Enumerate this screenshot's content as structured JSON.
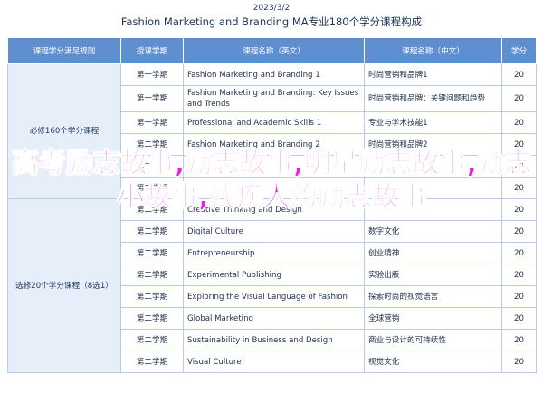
{
  "page": {
    "top_label": "2023/3/2",
    "title": "Fashion Marketing and Branding MA专业180个学分课程构成"
  },
  "table": {
    "headers": [
      "课程学分满足规则",
      "授课学期",
      "课程名称（英文）",
      "课程名称（中文）",
      "学分"
    ],
    "groups": [
      {
        "category": "必修160个学分课程",
        "rows": [
          {
            "semester": "第一学期",
            "en": "Fashion Marketing and Branding 1",
            "zh": "时尚营销和品牌1",
            "credit": "20"
          },
          {
            "semester": "第一学期",
            "en": "Fashion Marketing and Branding: Key Issues and Trends",
            "zh": "时尚营销和品牌：关键问题和趋势",
            "credit": "20"
          },
          {
            "semester": "第一学期",
            "en": "Professional and Academic Skills 1",
            "zh": "专业与学术技能1",
            "credit": "20"
          },
          {
            "semester": "第二学期",
            "en": "Fashion Marketing and Branding 2",
            "zh": "时尚营销和品牌2",
            "credit": "20"
          },
          {
            "semester": "第二学期",
            "en": "",
            "zh": "",
            "credit": "20"
          },
          {
            "semester": "第二学期",
            "en": "",
            "zh": "",
            "credit": "20"
          }
        ]
      },
      {
        "category": "选修20个学分课程（8选1）",
        "rows": [
          {
            "semester": "第二学期",
            "en": "Creative Thinking and Design",
            "zh": "",
            "credit": "20"
          },
          {
            "semester": "第二学期",
            "en": "Digital Culture",
            "zh": "数字文化",
            "credit": "20"
          },
          {
            "semester": "第二学期",
            "en": "Entrepreneurship",
            "zh": "创业精神",
            "credit": "20"
          },
          {
            "semester": "第二学期",
            "en": "Experimental Publishing",
            "zh": "实验出版",
            "credit": "20"
          },
          {
            "semester": "第二学期",
            "en": "Exploring the Visual Language of Fashion",
            "zh": "探索时尚的视觉语言",
            "credit": "20"
          },
          {
            "semester": "第二学期",
            "en": "Global Marketing",
            "zh": "全球营销",
            "credit": "20"
          },
          {
            "semester": "第二学期",
            "en": "Sustainability in Business and Design",
            "zh": "商业与设计的可持续性",
            "credit": "20"
          },
          {
            "semester": "第二学期",
            "en": "Visual Culture",
            "zh": "视觉文化",
            "credit": "20"
          }
        ]
      }
    ]
  },
  "overlay_text": "高考励志故事,励志故事,明星励志故事,励志小故事,残疾人的励志故事",
  "colors": {
    "header_bg": "#5e8fd1",
    "category_bg": "#e6eef9",
    "border": "#b9cbe4",
    "overlay": "#e81ee0"
  }
}
